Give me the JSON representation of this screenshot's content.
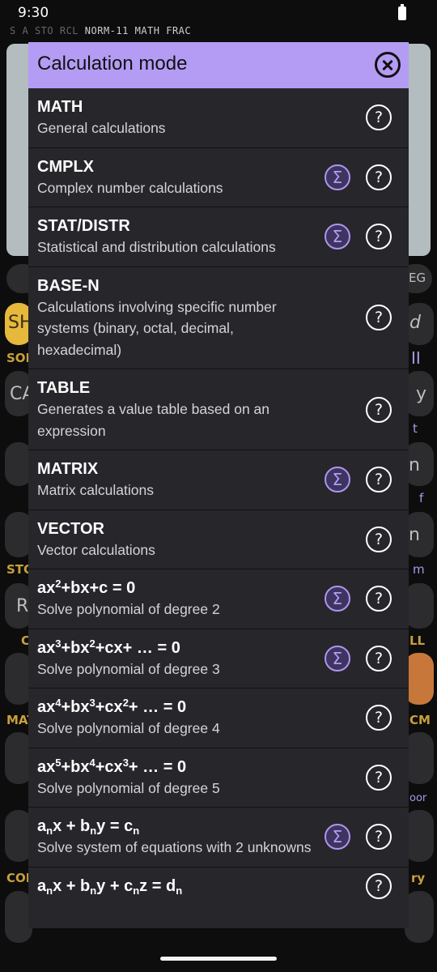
{
  "status_bar": {
    "time": "9:30"
  },
  "calc_flags": [
    "S",
    "A",
    "STO",
    "RCL",
    "NORM-11",
    "MATH",
    "FRAC"
  ],
  "background_keys": {
    "labels_left": [
      "SH",
      "SOL",
      "CA",
      "STO",
      "R",
      "C",
      "MAT",
      "COP"
    ],
    "labels_right": [
      "EG",
      "d",
      "II",
      "y",
      "t",
      "n",
      "f",
      "n",
      "m",
      "LL",
      "CM",
      "oor",
      "ry"
    ]
  },
  "dialog": {
    "title": "Calculation mode",
    "close_icon": "close-circle-icon",
    "sigma_icon": "sigma-icon",
    "help_icon": "help-circle-icon",
    "help_glyph": "?",
    "sigma_glyph": "Σ",
    "items": [
      {
        "name": "MATH",
        "description": "General calculations",
        "has_sigma": false
      },
      {
        "name": "CMPLX",
        "description": "Complex number calculations",
        "has_sigma": true
      },
      {
        "name": "STAT/DISTR",
        "description": "Statistical and distribution calculations",
        "has_sigma": true
      },
      {
        "name": "BASE-N",
        "description": "Calculations involving specific number systems (binary, octal, decimal, hexadecimal)",
        "has_sigma": false
      },
      {
        "name": "TABLE",
        "description": "Generates a value table based on an expression",
        "has_sigma": false
      },
      {
        "name": "MATRIX",
        "description": "Matrix calculations",
        "has_sigma": true
      },
      {
        "name": "VECTOR",
        "description": "Vector calculations",
        "has_sigma": false
      },
      {
        "name": "ax^2+bx+c = 0",
        "description": "Solve polynomial of degree 2",
        "has_sigma": true
      },
      {
        "name": "ax^3+bx^2+cx+ … = 0",
        "description": "Solve polynomial of degree 3",
        "has_sigma": true
      },
      {
        "name": "ax^4+bx^3+cx^2+ … = 0",
        "description": "Solve polynomial of degree 4",
        "has_sigma": false
      },
      {
        "name": "ax^5+bx^4+cx^3+ … = 0",
        "description": "Solve polynomial of degree 5",
        "has_sigma": false
      },
      {
        "name": "a_nx + b_ny = c_n",
        "description": "Solve system of equations with 2 unknowns",
        "has_sigma": true
      },
      {
        "name": "a_nx + b_ny + c_nz = d_n",
        "description": "",
        "has_sigma": false
      }
    ]
  },
  "accent_color": "#b49cf4",
  "screen_color": "#b3bcbf"
}
